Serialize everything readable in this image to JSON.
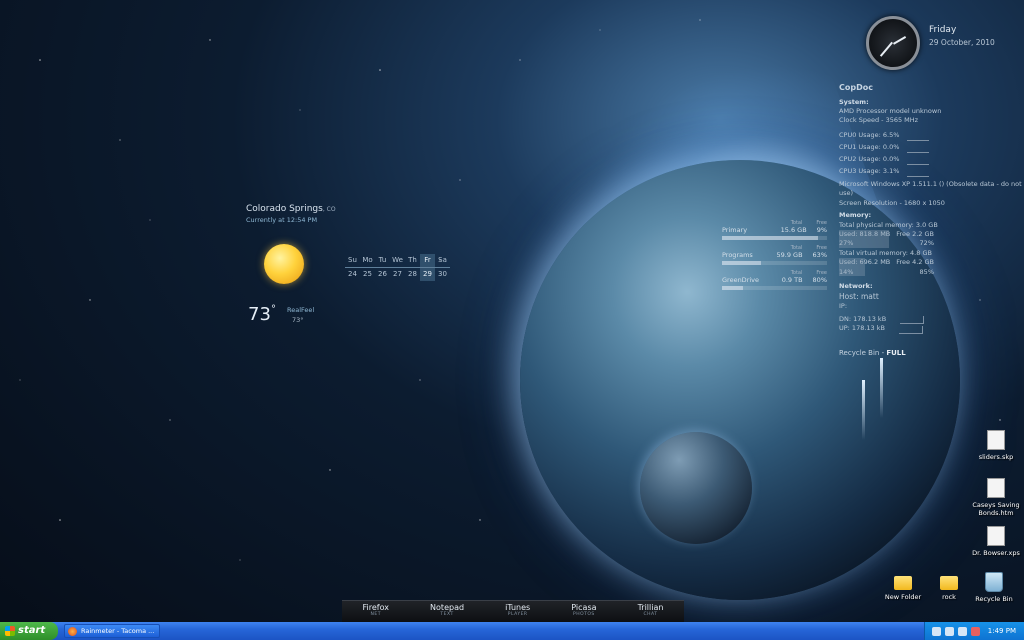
{
  "clock": {
    "day": "Friday",
    "date": "29 October, 2010"
  },
  "system": {
    "hostname": "CopDoc",
    "section_system": "System:",
    "processor": "AMD Processor model unknown",
    "clock_speed": "Clock Speed - 3565 MHz",
    "cpus": [
      {
        "label": "CPU0 Usage: 6.5%"
      },
      {
        "label": "CPU1 Usage: 0.0%"
      },
      {
        "label": "CPU2 Usage: 0.0%"
      },
      {
        "label": "CPU3 Usage: 3.1%"
      }
    ],
    "os": "Microsoft Windows XP 1.511.1 () (Obsolete data - do not use)",
    "resolution": "Screen Resolution - 1680 x 1050",
    "section_memory": "Memory:",
    "physical_total": "Total physical memory: 3.0 GB",
    "physical_used": "Used: 818.8 MB",
    "physical_free": "Free 2.2 GB",
    "physical_used_pct": "27%",
    "physical_free_pct": "72%",
    "physical_used_fraction": 0.27,
    "virtual_total": "Total virtual memory: 4.8 GB",
    "virtual_used": "Used: 696.2 MB",
    "virtual_free": "Free 4.2 GB",
    "virtual_used_pct": "14%",
    "virtual_free_pct": "85%",
    "virtual_used_fraction": 0.14,
    "section_network": "Network:",
    "host": "Host: matt",
    "ip": "IP:",
    "dn": "DN:   178.13 kB",
    "up": "UP:   178.13 kB",
    "recycle_label": "Recycle Bin -",
    "recycle_status": "FULL"
  },
  "drives": {
    "col_total": "Total",
    "col_free": "Free",
    "items": [
      {
        "name": "Primary",
        "total": "15.6 GB",
        "free": "9%",
        "used_fraction": 0.91
      },
      {
        "name": "Programs",
        "total": "59.9 GB",
        "free": "63%",
        "used_fraction": 0.37
      },
      {
        "name": "GreenDrive",
        "total": "0.9 TB",
        "free": "80%",
        "used_fraction": 0.2
      }
    ]
  },
  "weather": {
    "city": "Colorado Springs",
    "state": ", CO",
    "currently": "Currently at 12:54 PM",
    "temp": "73",
    "unit": "°",
    "realfeel_label": "RealFeel",
    "realfeel": "73°",
    "condition_icon": "sun-icon"
  },
  "calendar": {
    "days": [
      "Su",
      "Mo",
      "Tu",
      "We",
      "Th",
      "Fr",
      "Sa"
    ],
    "dates": [
      "24",
      "25",
      "26",
      "27",
      "28",
      "29",
      "30"
    ],
    "today_index": 5
  },
  "dock": [
    {
      "name": "Firefox",
      "sub": "NET"
    },
    {
      "name": "Notepad",
      "sub": "TEXT"
    },
    {
      "name": "iTunes",
      "sub": "PLAYER"
    },
    {
      "name": "Picasa",
      "sub": "PHOTOS"
    },
    {
      "name": "Trillian",
      "sub": "CHAT"
    }
  ],
  "desktop_icons": [
    {
      "label": "sliders.skp"
    },
    {
      "label": "Caseys Saving Bonds.htm"
    },
    {
      "label": "Dr. Bowser.xps"
    },
    {
      "label": "New Folder"
    },
    {
      "label": "rock"
    },
    {
      "label": "Recycle Bin"
    }
  ],
  "taskbar": {
    "start": "start",
    "window": "Rainmeter - Tacoma ...",
    "time": "1:49 PM"
  }
}
